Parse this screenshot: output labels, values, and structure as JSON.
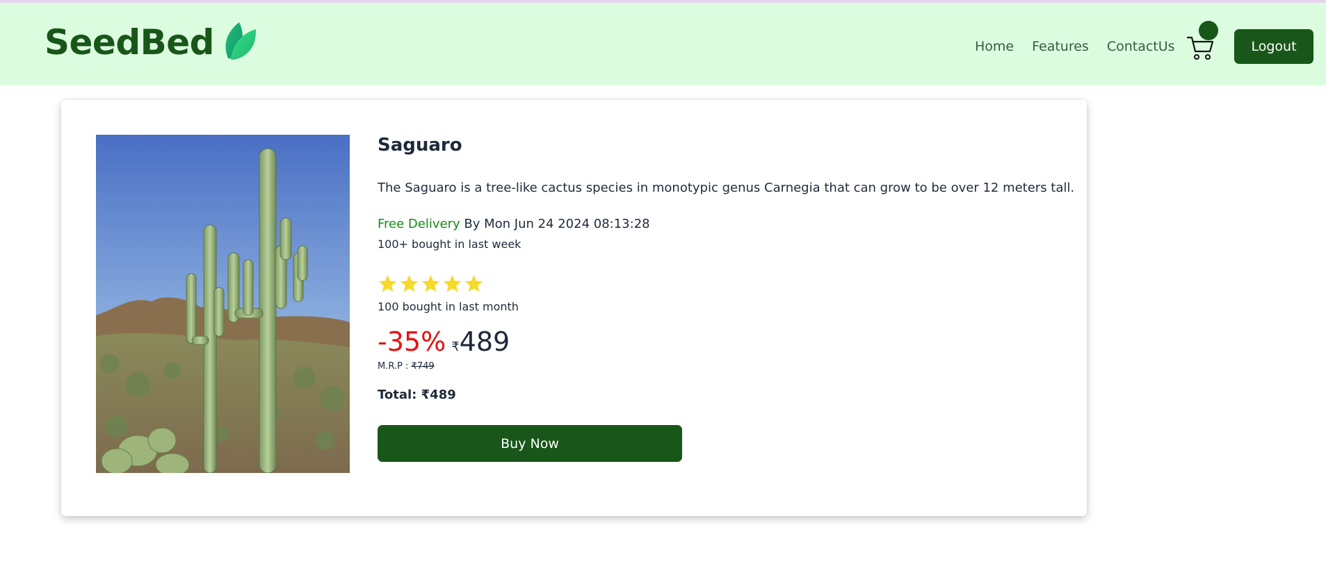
{
  "header": {
    "brand": "SeedBed",
    "nav": [
      "Home",
      "Features",
      "ContactUs"
    ],
    "logout_label": "Logout"
  },
  "product": {
    "name": "Saguaro",
    "description": "The Saguaro is a tree-like cactus species in monotypic genus Carnegia that can grow to be over 12 meters tall.",
    "delivery_highlight": "Free Delivery",
    "delivery_rest": " By Mon Jun 24 2024 08:13:28",
    "bought_week": "100+ bought in last week",
    "rating": 5,
    "bought_month": "100 bought in last month",
    "discount": "-35%",
    "currency": "₹",
    "price": "489",
    "mrp_label": "M.R.P : ",
    "mrp_value": "₹749",
    "total": "Total: ₹489",
    "buy_label": "Buy Now"
  },
  "colors": {
    "header_bg": "#dcfce0",
    "brand_green": "#195619",
    "discount_red": "#e81010",
    "free_green": "#168a16",
    "star_yellow": "#f7d92a"
  },
  "icons": [
    "leaf-logo-icon",
    "cart-icon",
    "star-icon"
  ]
}
